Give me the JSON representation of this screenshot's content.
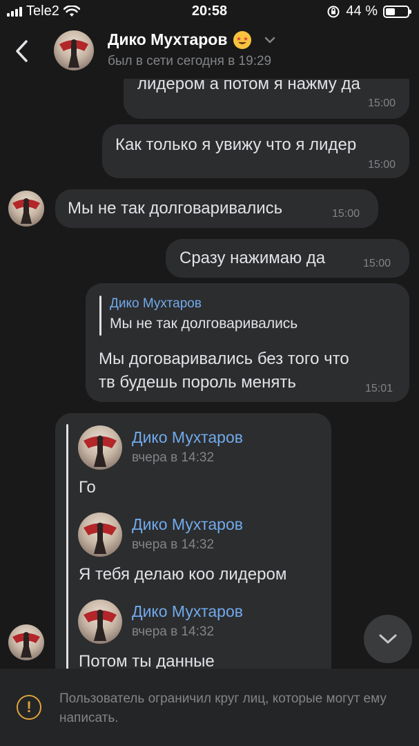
{
  "status_bar": {
    "carrier": "Tele2",
    "time": "20:58",
    "battery_percent": "44 %",
    "battery_level": 0.44
  },
  "header": {
    "name": "Дико Мухтаров",
    "status": "был в сети сегодня в 19:29",
    "emoji": "star-struck-emoji"
  },
  "messages": [
    {
      "dir": "out",
      "text": "лидером а потом я нажму да",
      "time": "15:00"
    },
    {
      "dir": "out",
      "text": "Как только я увижу что я лидер",
      "time": "15:00"
    },
    {
      "dir": "in",
      "text": "Мы не так долговаривались",
      "time": "15:00"
    },
    {
      "dir": "out",
      "text": "Сразу нажимаю да",
      "time": "15:00"
    },
    {
      "dir": "out",
      "reply": {
        "author": "Дико Мухтаров",
        "text": "Мы не так долговаривались"
      },
      "lines": [
        "Мы договаривались без того что",
        "тв будешь пороль менять"
      ],
      "time": "15:01"
    },
    {
      "dir": "in",
      "forwarded": [
        {
          "author": "Дико Мухтаров",
          "date": "вчера в 14:32",
          "text": "Го"
        },
        {
          "author": "Дико Мухтаров",
          "date": "вчера в 14:32",
          "text": "Я тебя делаю коо лидером"
        },
        {
          "author": "Дико Мухтаров",
          "date": "вчера в 14:32",
          "text": "Потом ты данные"
        }
      ]
    }
  ],
  "footer": {
    "notice": "Пользователь ограничил круг лиц, которые могут ему написать."
  },
  "colors": {
    "background": "#19191a",
    "bubble": "#2c2d2f",
    "link": "#71aaeb",
    "warning": "#e0a43b"
  }
}
